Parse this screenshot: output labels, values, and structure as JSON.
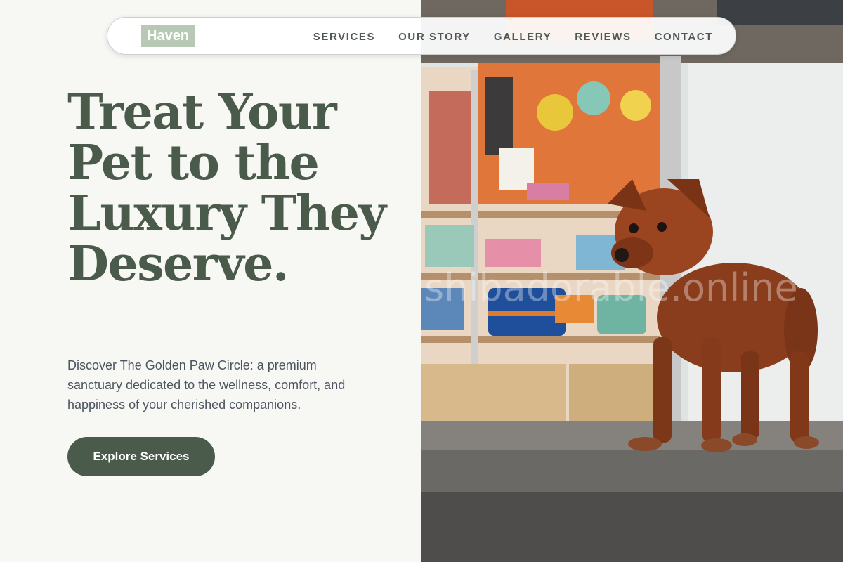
{
  "brand": {
    "logo_text": "Haven"
  },
  "nav": {
    "items": [
      {
        "label": "SERVICES"
      },
      {
        "label": "OUR STORY"
      },
      {
        "label": "GALLERY"
      },
      {
        "label": "REVIEWS"
      },
      {
        "label": "CONTACT"
      }
    ]
  },
  "hero": {
    "title": "Treat Your Pet to the Luxury They Deserve.",
    "subtitle": "Discover The Golden Paw Circle: a premium sanctuary dedicated to the wellness, comfort, and happiness of your cherished companions.",
    "cta_label": "Explore Services"
  },
  "image": {
    "watermark": "shibadorable.online"
  },
  "colors": {
    "accent": "#4a5a4b",
    "logo_bg": "#b7c8b5",
    "page_bg": "#f7f7f4",
    "body_text": "#4c5560"
  }
}
